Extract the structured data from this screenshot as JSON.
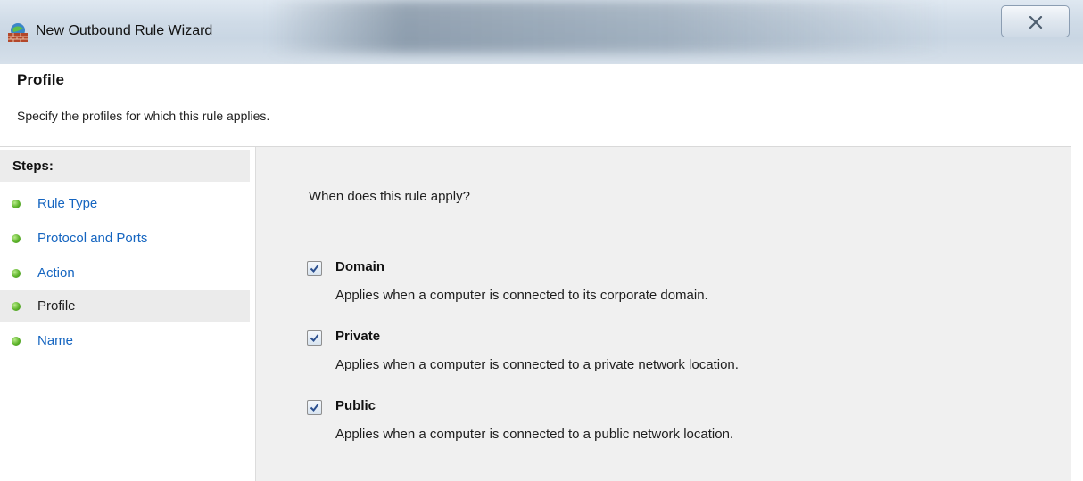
{
  "window": {
    "title": "New Outbound Rule Wizard",
    "close_label": "Close"
  },
  "header": {
    "title": "Profile",
    "subtitle": "Specify the profiles for which this rule applies."
  },
  "steps": {
    "heading": "Steps:",
    "items": [
      {
        "label": "Rule Type",
        "current": false
      },
      {
        "label": "Protocol and Ports",
        "current": false
      },
      {
        "label": "Action",
        "current": false
      },
      {
        "label": "Profile",
        "current": true
      },
      {
        "label": "Name",
        "current": false
      }
    ]
  },
  "content": {
    "question": "When does this rule apply?",
    "profiles": [
      {
        "name": "Domain",
        "checked": true,
        "description": "Applies when a computer is connected to its corporate domain."
      },
      {
        "name": "Private",
        "checked": true,
        "description": "Applies when a computer is connected to a private network location."
      },
      {
        "name": "Public",
        "checked": true,
        "description": "Applies when a computer is connected to a public network location."
      }
    ]
  },
  "colors": {
    "link": "#1565c0",
    "step_dot": "#5db32a",
    "content_bg": "#f0f0f0",
    "titlebar": "#cfdbe7"
  }
}
